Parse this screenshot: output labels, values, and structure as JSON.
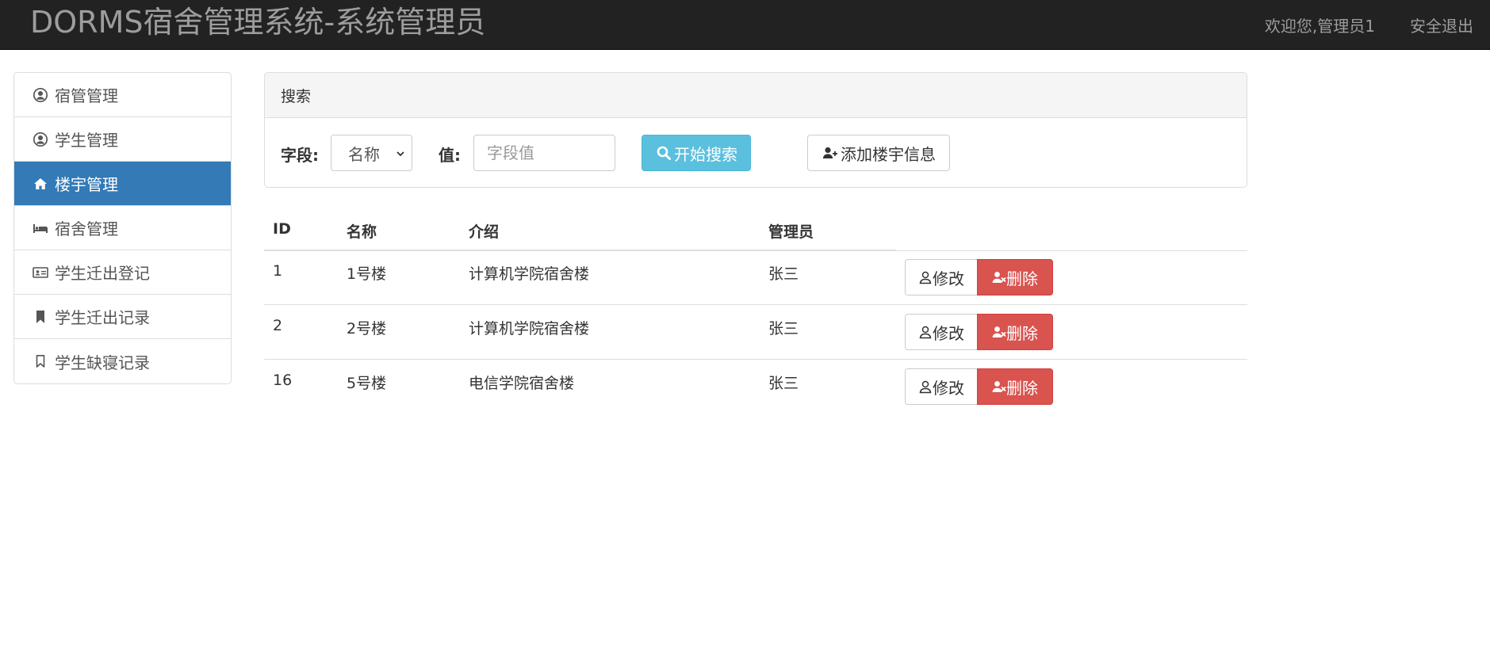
{
  "navbar": {
    "brand": "DORMS宿舍管理系统-系统管理员",
    "welcome": "欢迎您,管理员1",
    "logout": "安全退出"
  },
  "sidebar": {
    "items": [
      {
        "label": "宿管管理",
        "icon": "user-circle-icon"
      },
      {
        "label": "学生管理",
        "icon": "user-circle-icon"
      },
      {
        "label": "楼宇管理",
        "icon": "home-icon",
        "active": true
      },
      {
        "label": "宿舍管理",
        "icon": "bed-icon"
      },
      {
        "label": "学生迁出登记",
        "icon": "id-card-icon"
      },
      {
        "label": "学生迁出记录",
        "icon": "bookmark-icon"
      },
      {
        "label": "学生缺寝记录",
        "icon": "bookmark-outline-icon"
      }
    ]
  },
  "search": {
    "heading": "搜索",
    "field_label": "字段:",
    "field_selected": "名称",
    "value_label": "值:",
    "value_placeholder": "字段值",
    "value": "",
    "search_button": "开始搜索",
    "add_button": "添加楼宇信息"
  },
  "table": {
    "headers": [
      "ID",
      "名称",
      "介绍",
      "管理员"
    ],
    "rows": [
      {
        "id": "1",
        "name": "1号楼",
        "intro": "计算机学院宿舍楼",
        "admin": "张三"
      },
      {
        "id": "2",
        "name": "2号楼",
        "intro": "计算机学院宿舍楼",
        "admin": "张三"
      },
      {
        "id": "16",
        "name": "5号楼",
        "intro": "电信学院宿舍楼",
        "admin": "张三"
      }
    ],
    "edit_label": "修改",
    "delete_label": "删除"
  },
  "colors": {
    "navbar": "#222222",
    "active": "#337ab7",
    "info": "#5bc0de",
    "danger": "#d9534f"
  }
}
